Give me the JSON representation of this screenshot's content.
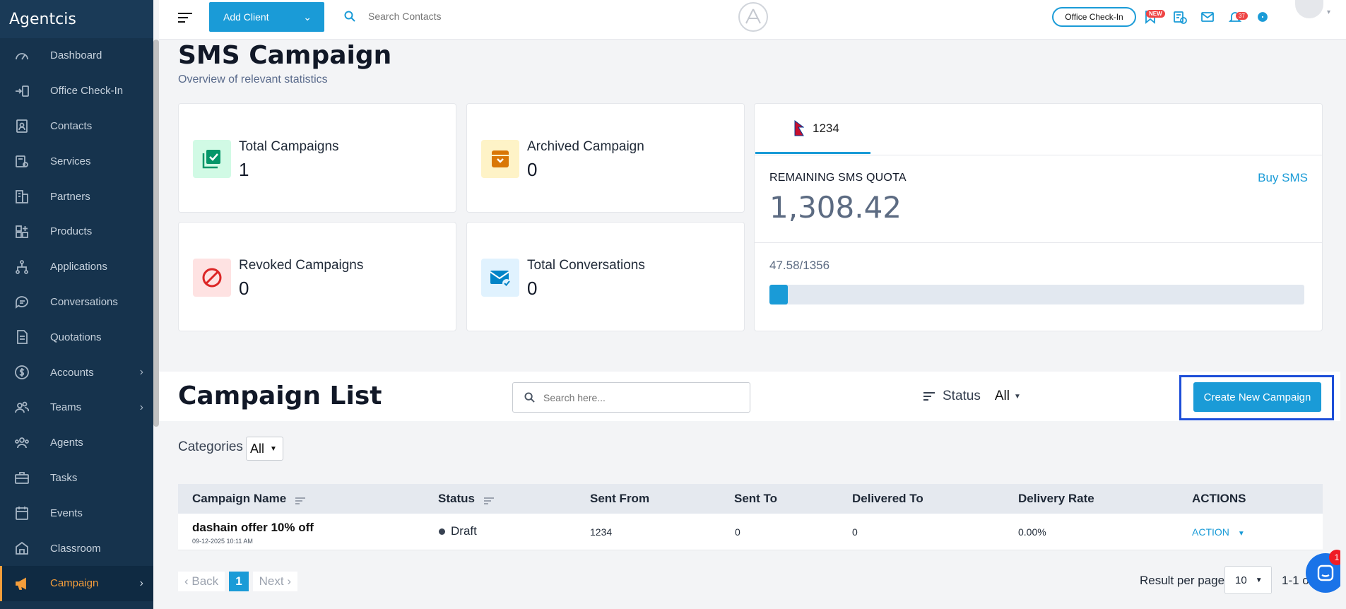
{
  "app": {
    "brand": "Agentcis"
  },
  "sidebar": {
    "items": [
      {
        "label": "Dashboard",
        "icon": "gauge-icon",
        "chevron": false,
        "active": false
      },
      {
        "label": "Office Check-In",
        "icon": "checkin-icon",
        "chevron": false,
        "active": false
      },
      {
        "label": "Contacts",
        "icon": "contact-card-icon",
        "chevron": false,
        "active": false
      },
      {
        "label": "Services",
        "icon": "services-icon",
        "chevron": false,
        "active": false
      },
      {
        "label": "Partners",
        "icon": "building-icon",
        "chevron": false,
        "active": false
      },
      {
        "label": "Products",
        "icon": "grid-plus-icon",
        "chevron": false,
        "active": false
      },
      {
        "label": "Applications",
        "icon": "flow-icon",
        "chevron": false,
        "active": false
      },
      {
        "label": "Conversations",
        "icon": "chat-bubble-icon",
        "chevron": false,
        "active": false
      },
      {
        "label": "Quotations",
        "icon": "document-icon",
        "chevron": false,
        "active": false
      },
      {
        "label": "Accounts",
        "icon": "dollar-icon",
        "chevron": true,
        "active": false
      },
      {
        "label": "Teams",
        "icon": "team-icon",
        "chevron": true,
        "active": false
      },
      {
        "label": "Agents",
        "icon": "agents-icon",
        "chevron": false,
        "active": false
      },
      {
        "label": "Tasks",
        "icon": "briefcase-icon",
        "chevron": false,
        "active": false
      },
      {
        "label": "Events",
        "icon": "calendar-icon",
        "chevron": false,
        "active": false
      },
      {
        "label": "Classroom",
        "icon": "classroom-icon",
        "chevron": false,
        "active": false
      },
      {
        "label": "Campaign",
        "icon": "megaphone-icon",
        "chevron": true,
        "active": true
      }
    ]
  },
  "topbar": {
    "add_client_label": "Add Client",
    "search_placeholder": "Search Contacts",
    "office_checkin_label": "Office Check-In",
    "new_badge": "NEW",
    "notifications_count": "37"
  },
  "page": {
    "title": "SMS Campaign",
    "subtitle": "Overview of relevant statistics"
  },
  "stats": [
    {
      "label": "Total Campaigns",
      "value": "1",
      "icon": "checklist-icon",
      "bg": "#d1fae5",
      "fg": "#059669"
    },
    {
      "label": "Archived Campaign",
      "value": "0",
      "icon": "archive-box-icon",
      "bg": "#fef3c7",
      "fg": "#d97706"
    },
    {
      "label": "Revoked Campaigns",
      "value": "0",
      "icon": "prohibited-icon",
      "bg": "#fee2e2",
      "fg": "#dc2626"
    },
    {
      "label": "Total Conversations",
      "value": "0",
      "icon": "mail-check-icon",
      "bg": "#e0f2fe",
      "fg": "#0284c7"
    }
  ],
  "quota": {
    "tab_number": "1234",
    "label": "REMAINING SMS QUOTA",
    "buy_label": "Buy SMS",
    "value": "1,308.42",
    "usage_label": "47.58/1356",
    "usage_fraction": 0.035
  },
  "campaign_list": {
    "title": "Campaign List",
    "search_placeholder": "Search here...",
    "status_label": "Status",
    "status_value": "All",
    "create_label": "Create New Campaign",
    "categories_label": "Categories",
    "categories_value": "All",
    "columns": [
      "Campaign Name",
      "Status",
      "Sent From",
      "Sent To",
      "Delivered To",
      "Delivery Rate",
      "ACTIONS"
    ],
    "rows": [
      {
        "name": "dashain offer 10% off",
        "date": "09-12-2025 10:11 AM",
        "status": "Draft",
        "sent_from": "1234",
        "sent_to": "0",
        "delivered_to": "0",
        "delivery_rate": "0.00%",
        "action": "ACTION"
      }
    ]
  },
  "pagination": {
    "back_label": "Back",
    "current_page": "1",
    "next_label": "Next",
    "result_per_page_label": "Result per page",
    "per_page_value": "10",
    "range_text": "1-1 of"
  },
  "chat": {
    "badge": "1"
  }
}
